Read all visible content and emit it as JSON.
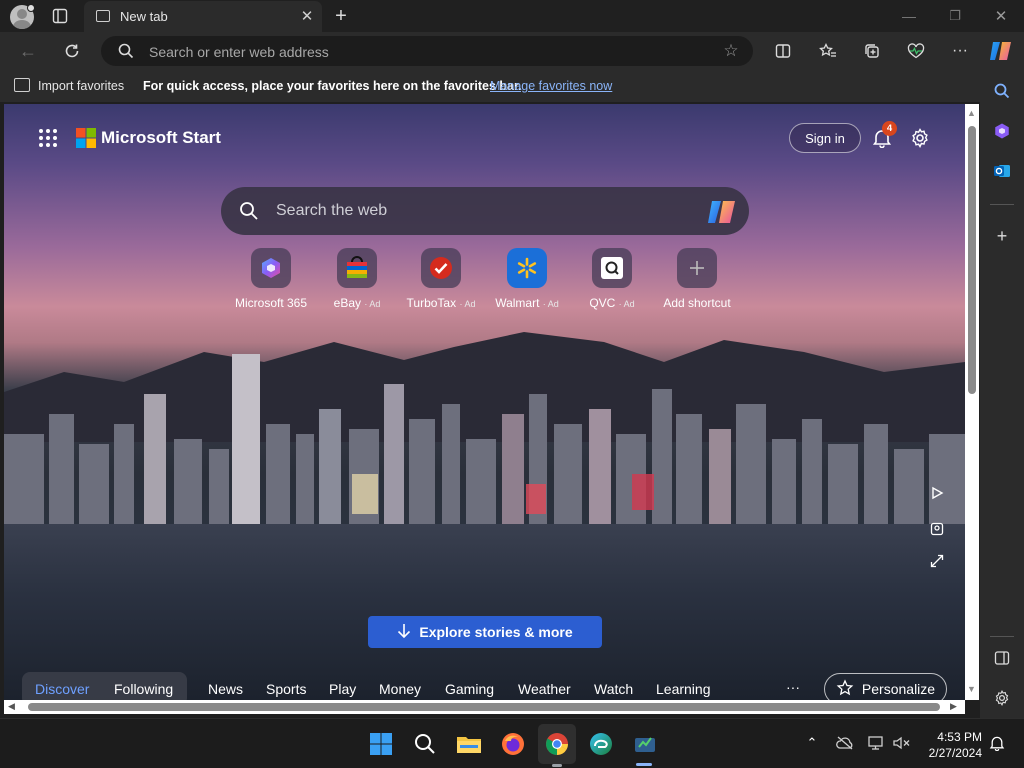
{
  "browser": {
    "tab_title": "New tab",
    "address_placeholder": "Search or enter web address"
  },
  "favorites_bar": {
    "import_label": "Import favorites",
    "hint": "For quick access, place your favorites here on the favorites bar.",
    "manage_link": "Manage favorites now"
  },
  "start_page": {
    "brand": "Microsoft Start",
    "sign_in": "Sign in",
    "notification_count": "4",
    "search_placeholder": "Search the web",
    "shortcuts": [
      {
        "label": "Microsoft 365",
        "ad": ""
      },
      {
        "label": "eBay",
        "ad": "· Ad"
      },
      {
        "label": "TurboTax",
        "ad": "· Ad"
      },
      {
        "label": "Walmart",
        "ad": "· Ad"
      },
      {
        "label": "QVC",
        "ad": "· Ad"
      },
      {
        "label": "Add shortcut",
        "ad": ""
      }
    ],
    "explore_button": "Explore stories & more",
    "feed_tabs": [
      "Discover",
      "Following",
      "News",
      "Sports",
      "Play",
      "Money",
      "Gaming",
      "Weather",
      "Watch",
      "Learning"
    ],
    "more_label": "···",
    "personalize": "Personalize"
  },
  "taskbar": {
    "time": "4:53 PM",
    "date": "2/27/2024"
  },
  "colors": {
    "accent_blue": "#2c5ed1",
    "link_blue": "#8ab4f8",
    "badge_orange": "#d9461d"
  }
}
